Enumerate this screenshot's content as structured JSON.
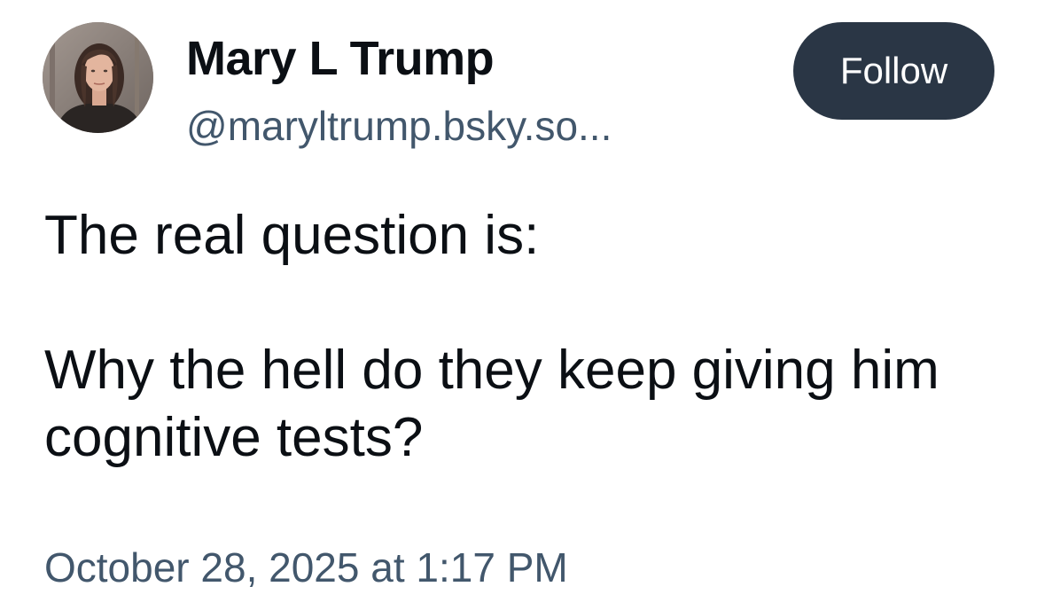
{
  "author": {
    "name": "Mary L Trump",
    "handle": "@maryltrump.bsky.so..."
  },
  "follow_button": {
    "label": "Follow"
  },
  "post": {
    "paragraphs": [
      "The real question is:",
      "Why the hell do they keep giving him cognitive tests?"
    ],
    "timestamp": "October 28, 2025 at 1:17 PM"
  },
  "colors": {
    "name_text": "#0b0f14",
    "secondary_text": "#42576c",
    "follow_button_bg": "#2a3645",
    "follow_button_text": "#ffffff",
    "background": "#ffffff"
  },
  "icons": {
    "avatar": "profile-photo"
  }
}
